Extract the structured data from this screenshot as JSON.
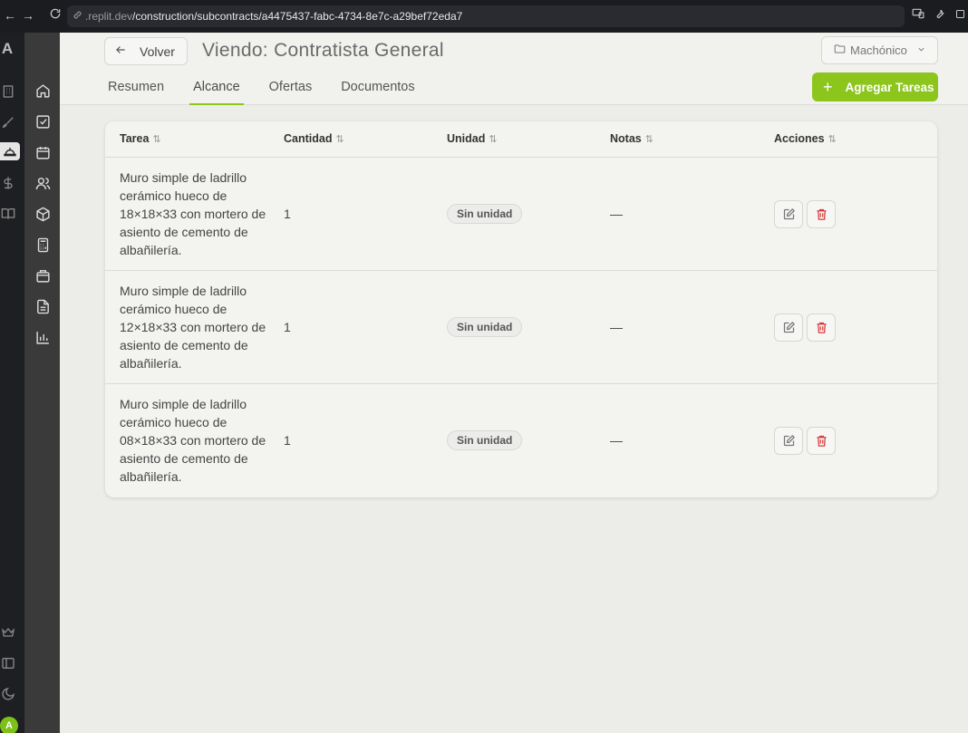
{
  "browser": {
    "url_host": ".replit.dev",
    "url_path": "/construction/subcontracts/a4475437-fabc-4734-8e7c-a29bef72eda7"
  },
  "app_strip": {
    "letter": "A",
    "avatar": "A",
    "icons": [
      "building-icon",
      "brush-icon",
      "hard-hat-icon",
      "dollar-icon",
      "book-icon"
    ],
    "bottom_icons": [
      "crown-icon",
      "sidebar-toggle-icon",
      "moon-icon"
    ]
  },
  "nav_sidebar": {
    "icons": [
      "home-icon",
      "checkbox-icon",
      "calendar-icon",
      "users-icon",
      "box-icon",
      "calculator-icon",
      "package-icon",
      "file-icon",
      "bar-chart-icon"
    ]
  },
  "header": {
    "back_label": "Volver",
    "title": "Viendo: Contratista General",
    "project_select": "Machónico",
    "add_button": "Agregar Tareas"
  },
  "tabs": [
    {
      "label": "Resumen",
      "active": false
    },
    {
      "label": "Alcance",
      "active": true
    },
    {
      "label": "Ofertas",
      "active": false
    },
    {
      "label": "Documentos",
      "active": false
    }
  ],
  "table": {
    "columns": [
      "Tarea",
      "Cantidad",
      "Unidad",
      "Notas",
      "Acciones"
    ],
    "sort_glyph": "⇅",
    "rows": [
      {
        "task": "Muro simple de ladrillo cerámico hueco de 18×18×33 con mortero de asiento de cemento de albañilería.",
        "qty": "1",
        "unit": "Sin unidad",
        "notes": "—"
      },
      {
        "task": "Muro simple de ladrillo cerámico hueco de 12×18×33 con mortero de asiento de cemento de albañilería.",
        "qty": "1",
        "unit": "Sin unidad",
        "notes": "—"
      },
      {
        "task": "Muro simple de ladrillo cerámico hueco de 08×18×33 con mortero de asiento de cemento de albañilería.",
        "qty": "1",
        "unit": "Sin unidad",
        "notes": "—"
      }
    ]
  },
  "colors": {
    "accent": "#8cc51c",
    "danger": "#d63a3a",
    "sidebar": "#3a3a3a"
  }
}
